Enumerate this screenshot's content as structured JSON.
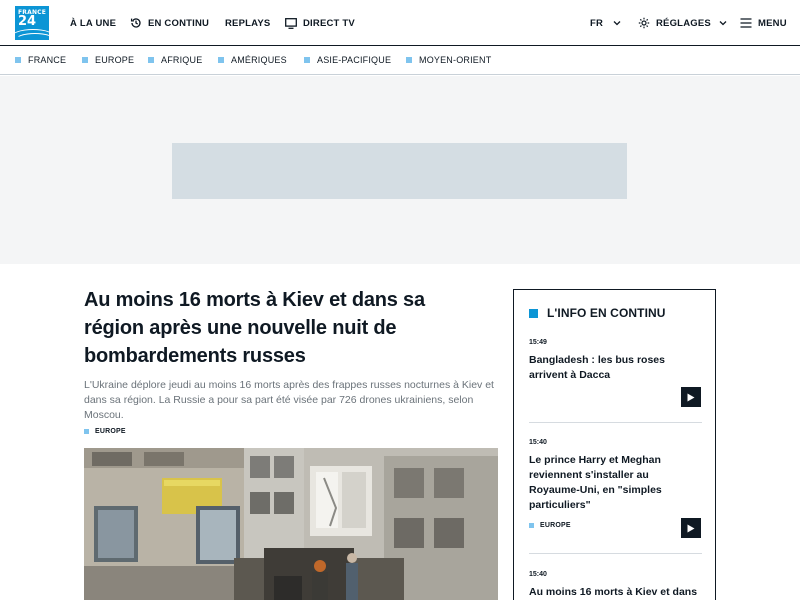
{
  "logo": {
    "line1": "FRANCE",
    "line2": "24"
  },
  "nav": {
    "a_la_une": "À LA UNE",
    "en_continu": "EN CONTINU",
    "replays": "REPLAYS",
    "direct_tv": "DIRECT TV",
    "language": "FR",
    "reglages": "RÉGLAGES",
    "menu": "MENU"
  },
  "regions": [
    "FRANCE",
    "EUROPE",
    "AFRIQUE",
    "AMÉRIQUES",
    "ASIE-PACIFIQUE",
    "MOYEN-ORIENT"
  ],
  "article": {
    "title": "Au moins 16 morts à Kiev et dans sa région après une nouvelle nuit de bombardements russes",
    "lede": "L'Ukraine déplore jeudi au moins 16 morts après des frappes russes nocturnes à Kiev et dans sa région. La Russie a pour sa part été visée par 726 drones ukrainiens, selon Moscou.",
    "tag": "EUROPE"
  },
  "live": {
    "title": "L'INFO EN CONTINU",
    "items": [
      {
        "time": "15:49",
        "text": "Bangladesh : les bus roses arrivent à Dacca",
        "tag": ""
      },
      {
        "time": "15:40",
        "text": "Le prince Harry et Meghan reviennent s'installer au Royaume-Uni, en \"simples particuliers\"",
        "tag": "EUROPE"
      },
      {
        "time": "15:40",
        "text": "Au moins 16 morts à Kiev et dans",
        "tag": ""
      }
    ]
  },
  "colors": {
    "brand": "#0c95d5",
    "region_marker": "#7fc4ee",
    "ink": "#0f1923"
  },
  "icons": [
    "history-icon",
    "tv-icon",
    "chevron-down-icon",
    "gear-icon",
    "hamburger-icon",
    "play-icon"
  ]
}
